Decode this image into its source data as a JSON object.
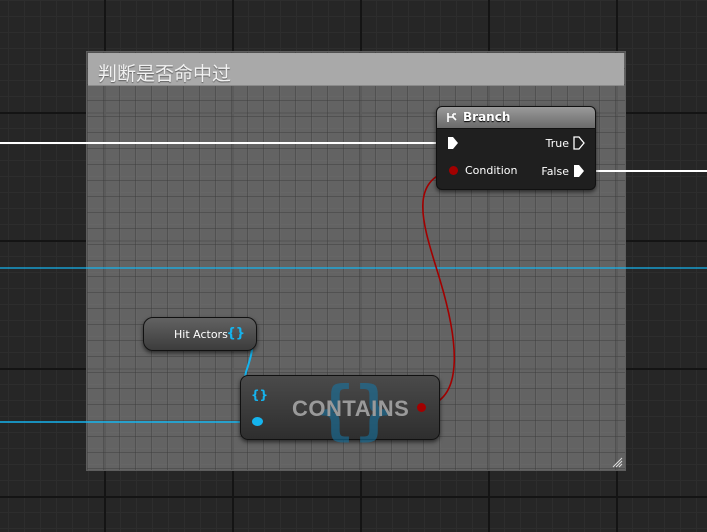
{
  "comment": {
    "title": "判断是否命中过"
  },
  "branch_node": {
    "title": "Branch",
    "true_label": "True",
    "condition_label": "Condition",
    "false_label": "False"
  },
  "variable_node": {
    "label": "Hit Actors",
    "pin_symbol": "{}"
  },
  "contains_node": {
    "title": "CONTAINS",
    "bg_symbol": "{}",
    "pin_symbol": "{}"
  },
  "colors": {
    "exec_wire": "#ffffff",
    "array_wire": "#15b4ee",
    "bool_wire": "#a20000",
    "comment_header": "#a9a9a9"
  },
  "icons": [
    "branch-icon",
    "exec-pin-icon",
    "bool-pin-icon",
    "array-pin-icon",
    "resize-handle-icon"
  ]
}
